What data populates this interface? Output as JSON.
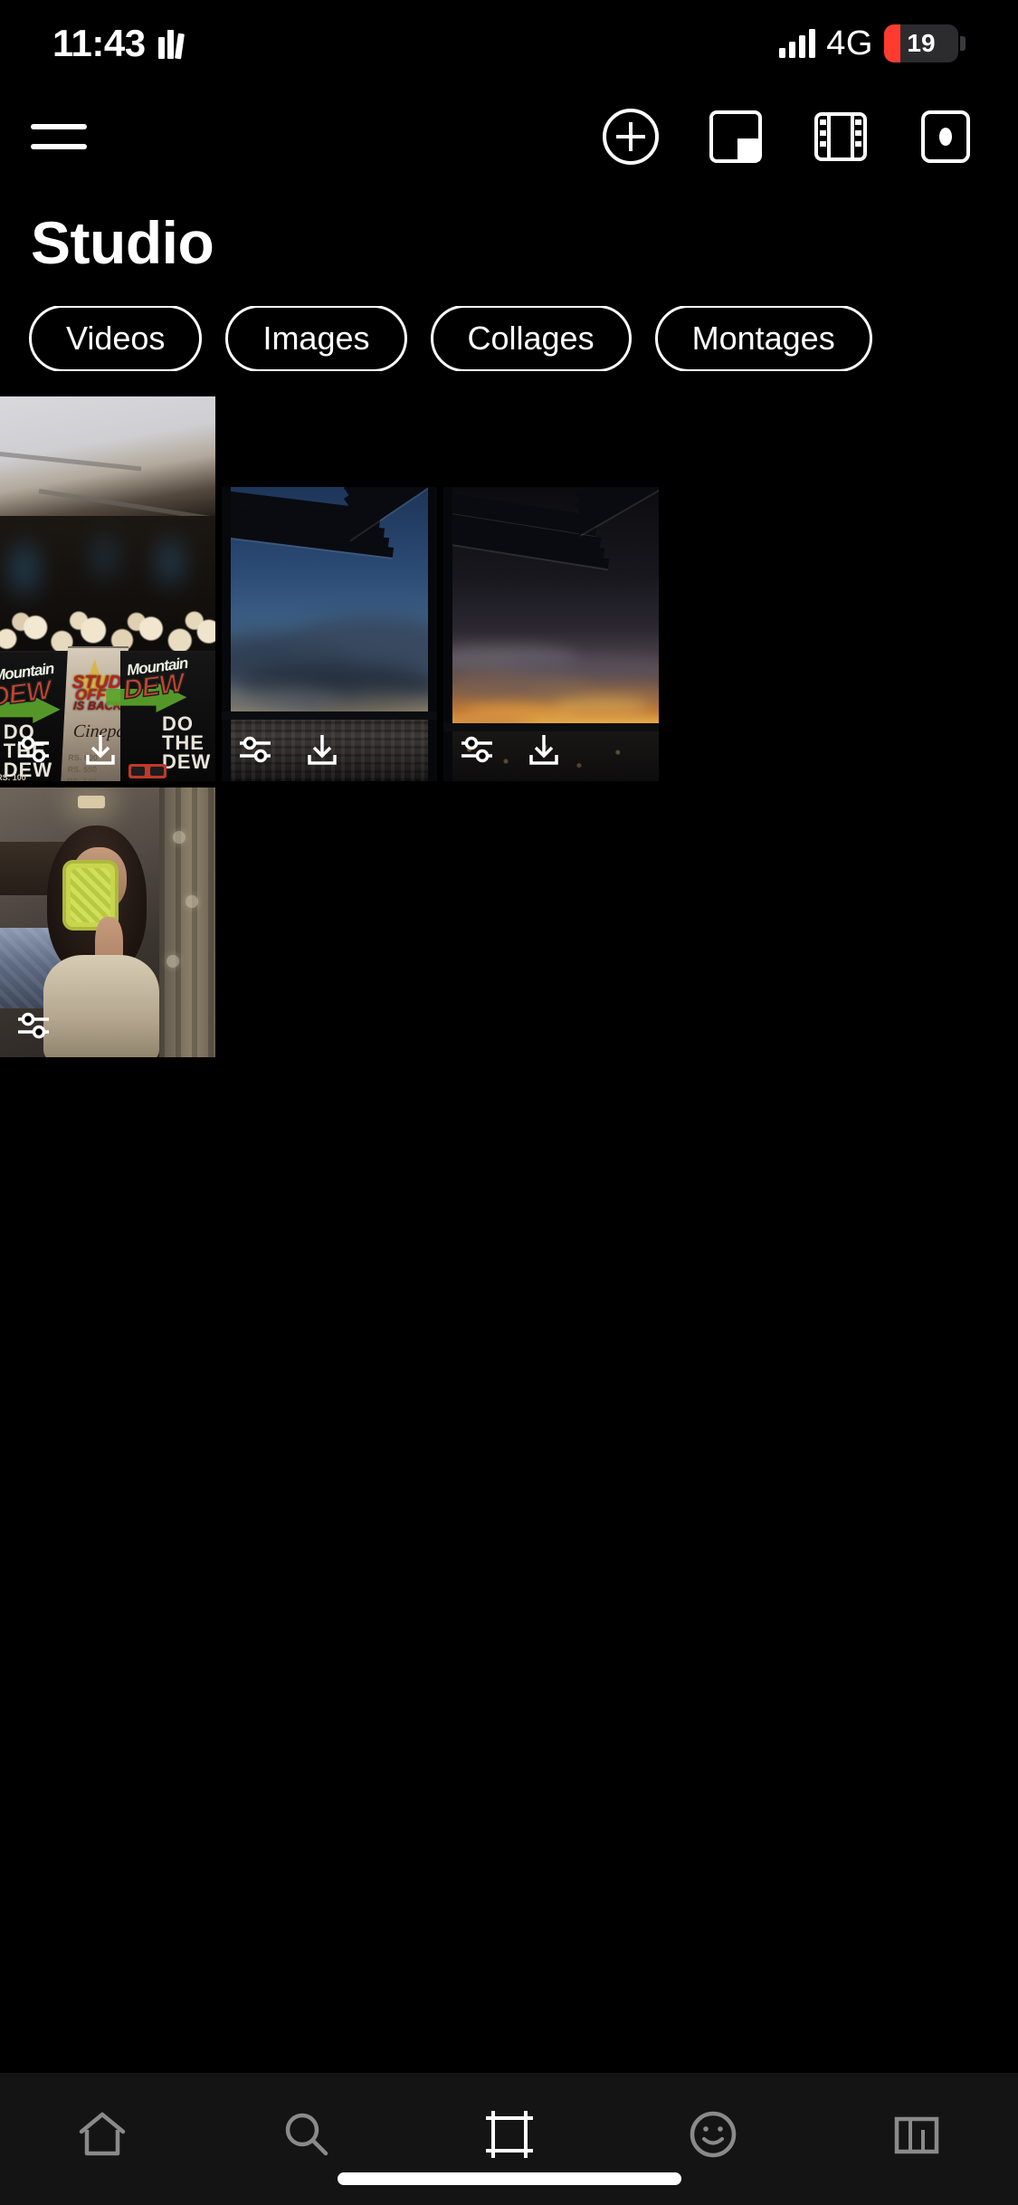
{
  "status_bar": {
    "time": "11:43",
    "books_icon": "books-icon",
    "network": "4G",
    "battery_percent": "19",
    "battery_color": "#ff3b30",
    "signal_icon": "signal-bars-icon"
  },
  "toolbar": {
    "menu_icon": "hamburger-menu-icon",
    "actions": [
      {
        "name": "add-new-button",
        "icon": "plus-circle-icon"
      },
      {
        "name": "collage-button",
        "icon": "collage-layout-icon"
      },
      {
        "name": "video-button",
        "icon": "film-strip-icon"
      },
      {
        "name": "story-button",
        "icon": "story-camera-icon"
      }
    ]
  },
  "header": {
    "title": "Studio"
  },
  "filters": {
    "chips": [
      {
        "label": "Videos"
      },
      {
        "label": "Images"
      },
      {
        "label": "Collages"
      },
      {
        "label": "Montages"
      }
    ]
  },
  "gallery": {
    "overlay_icons": {
      "edit": "sliders-tune-icon",
      "download": "download-icon"
    },
    "items": [
      {
        "name": "thumbnail-cinema-popcorn",
        "description": "Mountain Dew popcorn boxes at Cinepax cinema",
        "has_edit": true,
        "has_download": true,
        "texts": {
          "brand": "Mountain",
          "brand2": "DEW",
          "promo_line1": "STUD",
          "promo_line2": "OFF",
          "promo_line3": "IS BACK",
          "cinema": "Cinepax",
          "slogan": "DO THE DEW",
          "glasses": "3D GLASS",
          "prices": "RS. 100\nRS. 150\nRS. 200\nRS. 150\nRS. 140"
        }
      },
      {
        "name": "thumbnail-balcony-blue-sky",
        "description": "Balcony louvers with blue cloudy sky over city",
        "has_edit": true,
        "has_download": true
      },
      {
        "name": "thumbnail-balcony-sunset",
        "description": "Balcony louvers with orange sunset over city",
        "has_edit": true,
        "has_download": true
      },
      {
        "name": "thumbnail-mirror-selfie",
        "description": "Mirror selfie with green phone case in bedroom",
        "has_edit": true,
        "has_download": false
      }
    ]
  },
  "bottom_nav": {
    "items": [
      {
        "name": "nav-home",
        "icon": "home-icon",
        "active": false
      },
      {
        "name": "nav-search",
        "icon": "search-icon",
        "active": false
      },
      {
        "name": "nav-studio",
        "icon": "crop-frame-icon",
        "active": true
      },
      {
        "name": "nav-stickers",
        "icon": "smiley-face-icon",
        "active": false
      },
      {
        "name": "nav-charts",
        "icon": "bar-chart-icon",
        "active": false
      }
    ]
  },
  "system": {
    "home_indicator": "home-indicator-bar"
  }
}
